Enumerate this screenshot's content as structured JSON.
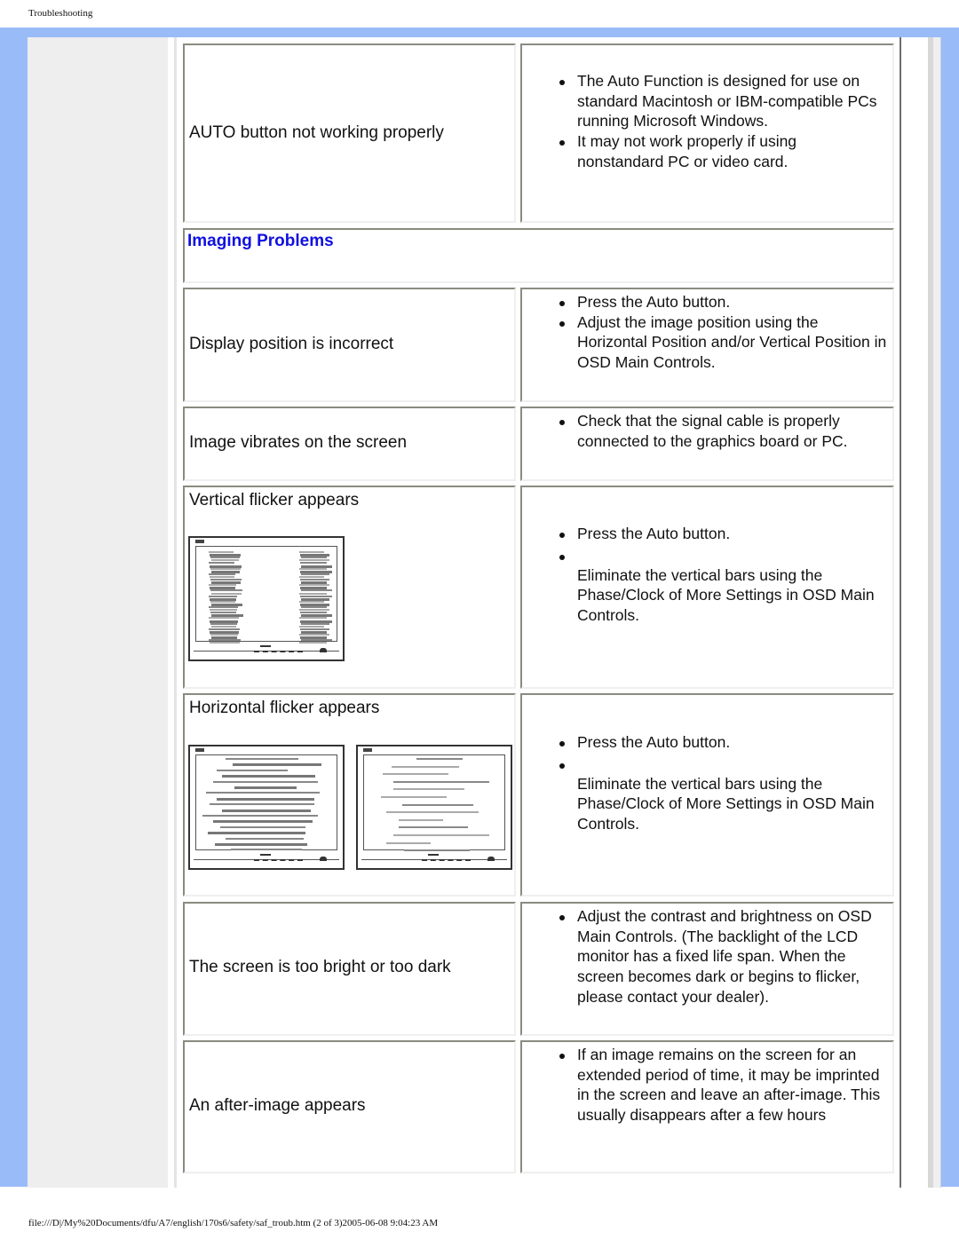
{
  "page": {
    "header_title": "Troubleshooting",
    "footer_text": "file:///D|/My%20Documents/dfu/A7/english/170s6/safety/saf_troub.htm (2 of 3)2005-06-08 9:04:23 AM"
  },
  "colors": {
    "frame_blue": "#99bbf7",
    "heading_blue": "#1010e0",
    "sidebar_gray": "#eeeeee"
  },
  "rows": [
    {
      "problem": "AUTO button not working properly",
      "solutions": [
        "The Auto Function is designed for use on standard Macintosh or IBM-compatible PCs running Microsoft Windows.",
        "It may not work properly if using nonstandard PC or video card."
      ]
    },
    {
      "section_heading": "Imaging Problems"
    },
    {
      "problem": "Display position is incorrect",
      "solutions": [
        "Press the Auto button.",
        "Adjust the image position using the Horizontal Position and/or Vertical Position in OSD Main Controls."
      ]
    },
    {
      "problem": "Image vibrates on the screen",
      "solutions": [
        "Check that the signal cable is properly connected to the graphics board or PC."
      ]
    },
    {
      "problem": "Vertical flicker appears",
      "illustration": "monitor-vertical-flicker-image",
      "solutions": [
        "Press the Auto button.",
        "",
        "Eliminate the vertical bars using the Phase/Clock of More Settings in OSD Main Controls."
      ]
    },
    {
      "problem": "Horizontal flicker appears",
      "illustration": "monitor-horizontal-flicker-images",
      "solutions": [
        "Press the Auto button.",
        "",
        "Eliminate the vertical bars using the Phase/Clock of More Settings in OSD Main Controls."
      ]
    },
    {
      "problem": "The screen is too bright or too dark",
      "solutions": [
        "Adjust the contrast and brightness on OSD Main Controls. (The backlight of the LCD monitor has a fixed life span. When the screen becomes dark or begins to flicker, please contact your dealer)."
      ]
    },
    {
      "problem": "An after-image appears",
      "solutions": [
        "If an image remains on the screen for an extended period of time, it may be imprinted in the screen and leave an after-image. This usually disappears after a few hours"
      ]
    }
  ]
}
